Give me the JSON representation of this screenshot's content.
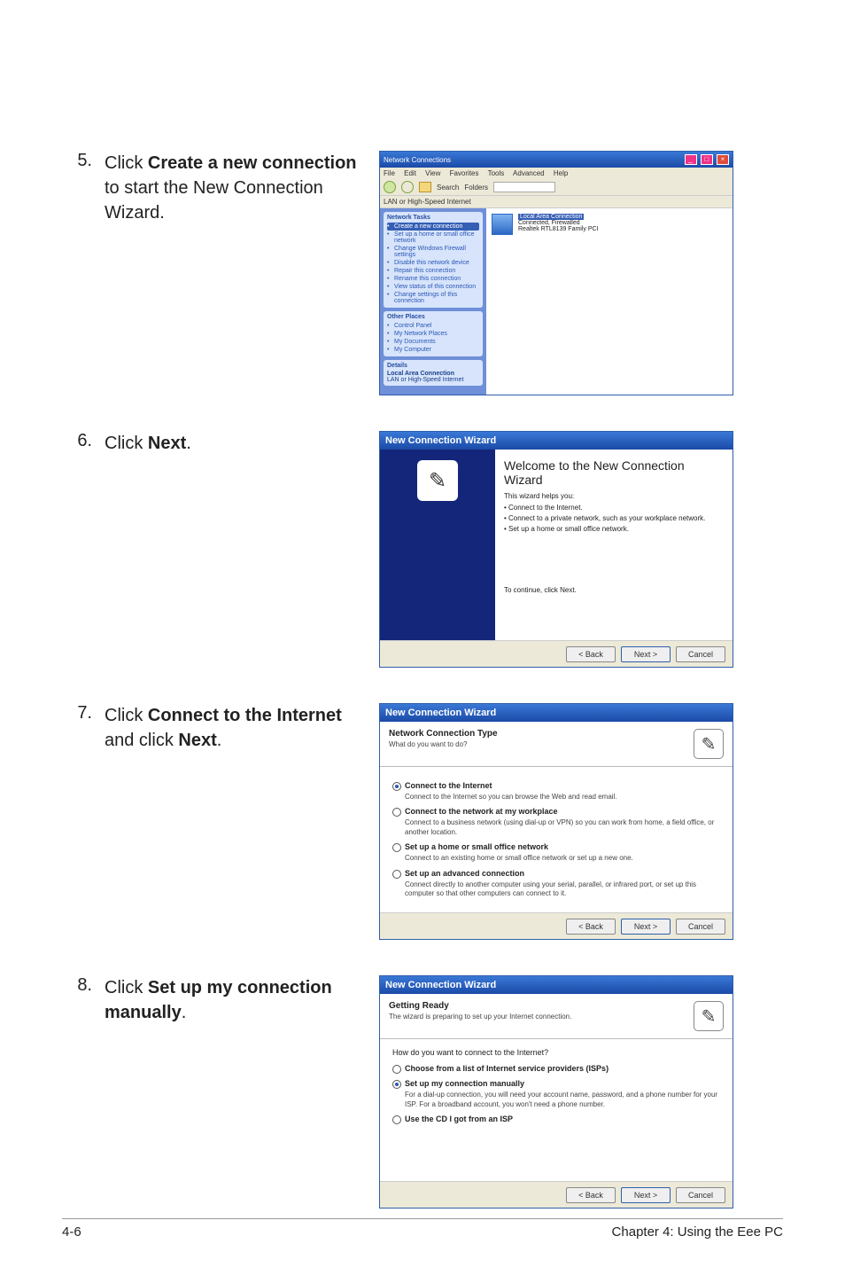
{
  "steps": {
    "s5": {
      "num": "5.",
      "text_pre": "Click ",
      "bold": "Create a new connection",
      "text_post": " to start the New Connection Wizard."
    },
    "s6": {
      "num": "6.",
      "text_pre": "Click ",
      "bold": "Next",
      "text_post": "."
    },
    "s7": {
      "num": "7.",
      "text_pre": "Click ",
      "bold1": "Connect to the Internet",
      "mid": " and click ",
      "bold2": "Next",
      "text_post": "."
    },
    "s8": {
      "num": "8.",
      "text_pre": "Click ",
      "bold": "Set up my connection manually",
      "text_post": "."
    }
  },
  "nc": {
    "title": "Network Connections",
    "menu": {
      "file": "File",
      "edit": "Edit",
      "view": "View",
      "favorites": "Favorites",
      "tools": "Tools",
      "advanced": "Advanced",
      "help": "Help"
    },
    "toolbar": {
      "search": "Search",
      "folders": "Folders"
    },
    "addressLabel": "LAN or High-Speed Internet",
    "tasksHeader": "Network Tasks",
    "tasks": [
      "Create a new connection",
      "Set up a home or small office network",
      "Change Windows Firewall settings",
      "Disable this network device",
      "Repair this connection",
      "Rename this connection",
      "View status of this connection",
      "Change settings of this connection"
    ],
    "placesHeader": "Other Places",
    "places": [
      "Control Panel",
      "My Network Places",
      "My Documents",
      "My Computer"
    ],
    "detailsHeader": "Details",
    "detailsLine1": "Local Area Connection",
    "detailsLine2": "LAN or High-Speed Internet",
    "connName": "Local Area Connection",
    "connStatus": "Connected, Firewalled",
    "connDevice": "Realtek RTL8139 Family PCI"
  },
  "wiz_title": "New Connection Wizard",
  "w6": {
    "heading": "Welcome to the New Connection Wizard",
    "intro": "This wizard helps you:",
    "b1": "•  Connect to the Internet.",
    "b2": "•  Connect to a private network, such as your workplace network.",
    "b3": "•  Set up a home or small office network.",
    "cont": "To continue, click Next."
  },
  "w7": {
    "head_t1": "Network Connection Type",
    "head_t2": "What do you want to do?",
    "o1_l": "Connect to the Internet",
    "o1_d": "Connect to the Internet so you can browse the Web and read email.",
    "o2_l": "Connect to the network at my workplace",
    "o2_d": "Connect to a business network (using dial-up or VPN) so you can work from home, a field office, or another location.",
    "o3_l": "Set up a home or small office network",
    "o3_d": "Connect to an existing home or small office network or set up a new one.",
    "o4_l": "Set up an advanced connection",
    "o4_d": "Connect directly to another computer using your serial, parallel, or infrared port, or set up this computer so that other computers can connect to it."
  },
  "w8": {
    "head_t1": "Getting Ready",
    "head_t2": "The wizard is preparing to set up your Internet connection.",
    "q": "How do you want to connect to the Internet?",
    "o1_l": "Choose from a list of Internet service providers (ISPs)",
    "o2_l": "Set up my connection manually",
    "o2_d": "For a dial-up connection, you will need your account name, password, and a phone number for your ISP. For a broadband account, you won't need a phone number.",
    "o3_l": "Use the CD I got from an ISP"
  },
  "buttons": {
    "back": "< Back",
    "next": "Next >",
    "cancel": "Cancel"
  },
  "footer": {
    "left": "4-6",
    "right": "Chapter 4: Using the Eee PC"
  }
}
